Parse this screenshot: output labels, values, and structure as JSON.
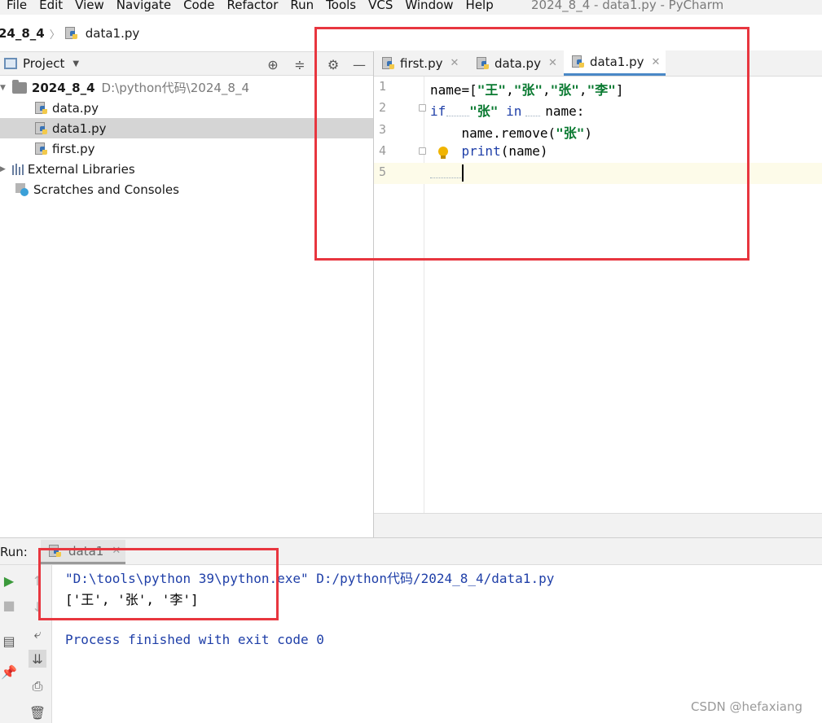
{
  "menubar": {
    "items": [
      "File",
      "Edit",
      "View",
      "Navigate",
      "Code",
      "Refactor",
      "Run",
      "Tools",
      "VCS",
      "Window",
      "Help"
    ],
    "window_title": "2024_8_4 - data1.py - PyCharm"
  },
  "breadcrumb": {
    "project": "24_8_4",
    "file": "data1.py"
  },
  "project_panel": {
    "title": "Project",
    "root_name": "2024_8_4",
    "root_path": "D:\\python代码\\2024_8_4",
    "files": [
      "data.py",
      "data1.py",
      "first.py"
    ],
    "external_libraries": "External Libraries",
    "scratches": "Scratches and Consoles"
  },
  "editor": {
    "tabs": [
      "first.py",
      "data.py",
      "data1.py"
    ],
    "active_tab": "data1.py",
    "line_numbers": [
      "1",
      "2",
      "3",
      "4",
      "5"
    ],
    "code": {
      "l1_a": "name=[",
      "l1_s1": "\"王\"",
      "l1_c1": ",",
      "l1_s2": "\"张\"",
      "l1_c2": ",",
      "l1_s3": "\"张\"",
      "l1_c3": ",",
      "l1_s4": "\"李\"",
      "l1_b": "]",
      "l2_if": "if",
      "l2_sp1": "   ",
      "l2_s": "\"张\"",
      "l2_sp2": " ",
      "l2_in": "in",
      "l2_rest": "   name:",
      "l3_a": "    name.remove(",
      "l3_s": "\"张\"",
      "l3_b": ")",
      "l4_a": "    ",
      "l4_kw": "print",
      "l4_b": "(name)"
    }
  },
  "run_panel": {
    "label": "Run:",
    "tab": "data1",
    "command": "\"D:\\tools\\python 39\\python.exe\" D:/python代码/2024_8_4/data1.py",
    "output": "['王', '张', '李']",
    "exit": "Process finished with exit code 0"
  },
  "watermark": "CSDN @hefaxiang",
  "colors": {
    "annotation": "#e8363f",
    "keyword": "#1f3fa8",
    "string": "#0a7a31",
    "tab_underline": "#4a88c7"
  }
}
